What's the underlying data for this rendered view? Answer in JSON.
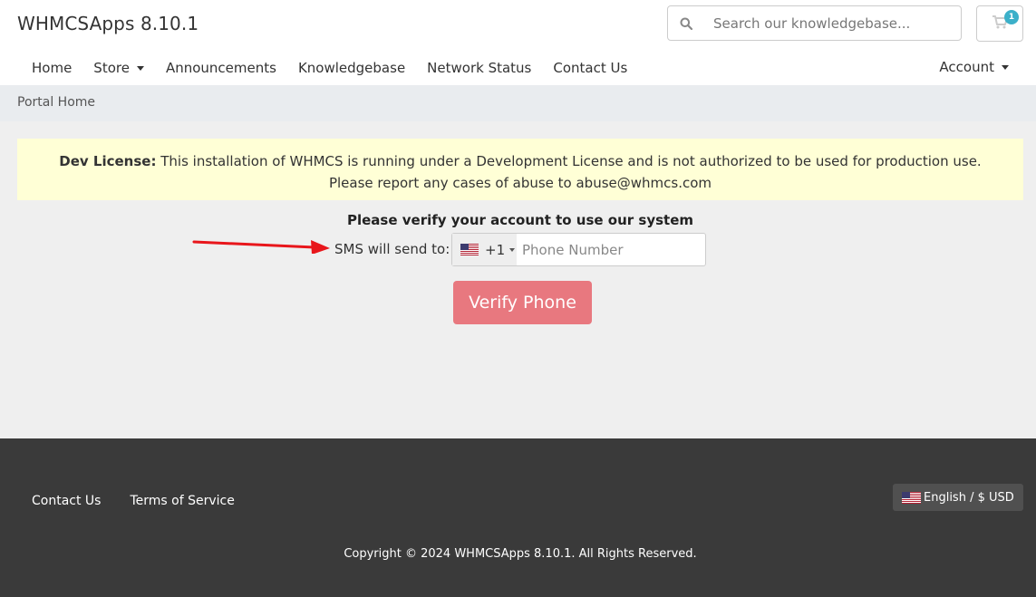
{
  "header": {
    "brand": "WHMCSApps 8.10.1",
    "search_placeholder": "Search our knowledgebase...",
    "cart_count": "1"
  },
  "nav": {
    "items": [
      "Home",
      "Store",
      "Announcements",
      "Knowledgebase",
      "Network Status",
      "Contact Us"
    ],
    "account": "Account"
  },
  "breadcrumb": "Portal Home",
  "alert": {
    "bold": "Dev License:",
    "line1": "This installation of WHMCS is running under a Development License and is not authorized to be used for production use.",
    "line2": "Please report any cases of abuse to abuse@whmcs.com"
  },
  "verify": {
    "title": "Please verify your account to use our system",
    "sms_label": "SMS will send to:",
    "country_code": "+1",
    "phone_placeholder": "Phone Number",
    "button": "Verify Phone"
  },
  "footer": {
    "links": [
      "Contact Us",
      "Terms of Service"
    ],
    "language": "English / $ USD",
    "copyright": "Copyright © 2024 WHMCSApps 8.10.1. All Rights Reserved."
  },
  "colors": {
    "verify_button": "#e8787f",
    "alert_bg": "#ffffd6",
    "footer_bg": "#3a3a3a",
    "badge": "#3cb0c9",
    "annotation_arrow": "#e8161b"
  }
}
